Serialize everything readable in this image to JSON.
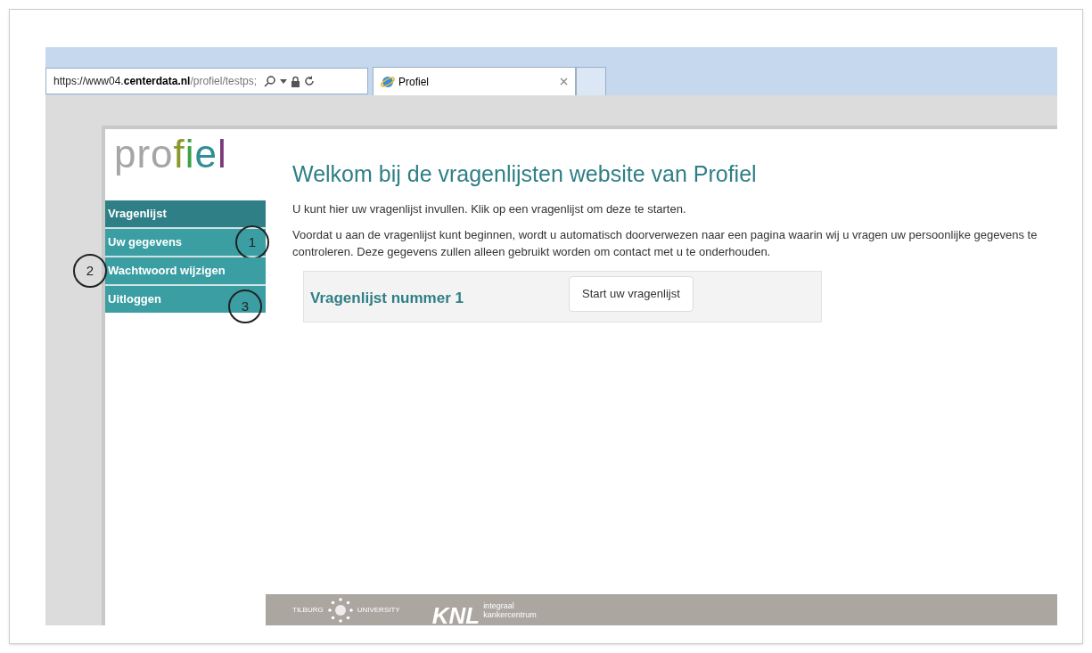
{
  "browser": {
    "url_prefix": "https://www04.",
    "url_domain": "centerdata.nl",
    "url_path": "/profiel/testps;",
    "tab_title": "Profiel"
  },
  "logo": [
    {
      "text": "pro",
      "color": "#a6a6a6"
    },
    {
      "text": "f",
      "color": "#8a9a2a"
    },
    {
      "text": "i",
      "color": "#3aa34a"
    },
    {
      "text": "e",
      "color": "#2f8f96"
    },
    {
      "text": "l",
      "color": "#7a3a7a"
    }
  ],
  "sidebar": {
    "items": [
      {
        "label": "Vragenlijst",
        "selected": true
      },
      {
        "label": "Uw gegevens",
        "selected": false
      },
      {
        "label": "Wachtwoord wijzigen",
        "selected": false
      },
      {
        "label": "Uitloggen",
        "selected": false
      }
    ]
  },
  "annotations": [
    "1",
    "2",
    "3"
  ],
  "main": {
    "title": "Welkom bij de vragenlijsten website van Profiel",
    "intro": "U kunt hier uw vragenlijst invullen. Klik op een vragenlijst om deze te starten.",
    "notice": "Voordat u aan de vragenlijst kunt beginnen, wordt u automatisch doorverwezen naar een pagina waarin wij u vragen uw persoonlijke gegevens te controleren. Deze gegevens zullen alleen gebruikt worden om contact met u te onderhouden.",
    "questionnaire": {
      "name": "Vragenlijst nummer 1",
      "button": "Start uw vragenlijst"
    }
  },
  "footer": {
    "tilburg_left": "TILBURG",
    "tilburg_right": "UNIVERSITY",
    "knl": "KNL",
    "knl_line_1": "integraal",
    "knl_line_2": "kankercentrum"
  }
}
